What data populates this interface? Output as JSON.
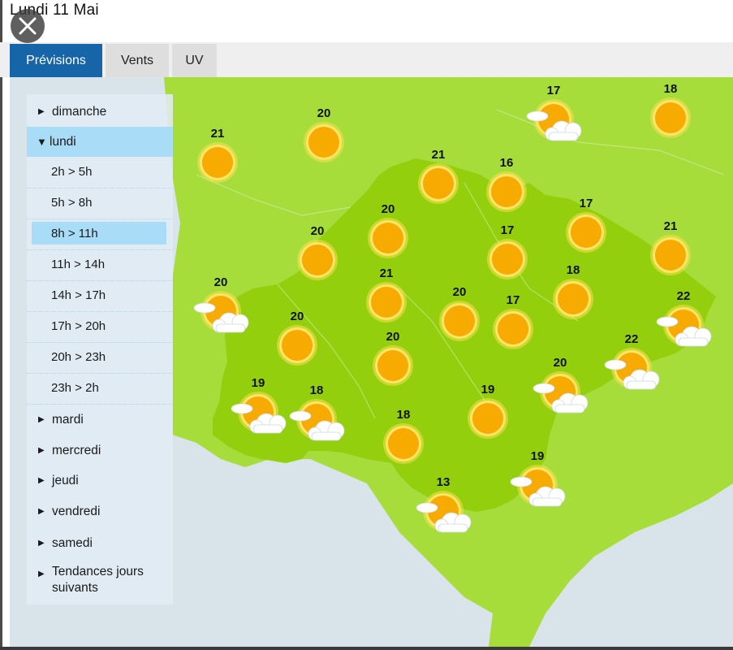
{
  "header": {
    "date": "Lundi  11 Mai"
  },
  "tabs": [
    {
      "label": "Prévisions",
      "active": true
    },
    {
      "label": "Vents",
      "active": false
    },
    {
      "label": "UV",
      "active": false
    }
  ],
  "sidebar": {
    "days_before": [
      {
        "label": "dimanche"
      }
    ],
    "open_day": {
      "label": "lundi"
    },
    "slots": [
      {
        "label": "2h > 5h"
      },
      {
        "label": "5h > 8h"
      },
      {
        "label": "8h > 11h",
        "selected": true
      },
      {
        "label": "11h > 14h"
      },
      {
        "label": "14h > 17h"
      },
      {
        "label": "17h > 20h"
      },
      {
        "label": "20h > 23h"
      },
      {
        "label": "23h > 2h"
      }
    ],
    "days_after": [
      {
        "label": "mardi"
      },
      {
        "label": "mercredi"
      },
      {
        "label": "jeudi"
      },
      {
        "label": "vendredi"
      },
      {
        "label": "samedi"
      },
      {
        "label": "Tendances jours suivants"
      }
    ]
  },
  "map": {
    "colors": {
      "sea": "#d9e3ea",
      "land_outside": "#a6dd3b",
      "region": "#94cf0e",
      "sun": "#f7ab00",
      "cloud": "#ffffff"
    },
    "forecasts": [
      {
        "temp": "17",
        "icon": "sun-cloud-icon"
      },
      {
        "temp": "18",
        "icon": "sun-icon"
      },
      {
        "temp": "20",
        "icon": "sun-icon"
      },
      {
        "temp": "21",
        "icon": "sun-icon"
      },
      {
        "temp": "21",
        "icon": "sun-icon"
      },
      {
        "temp": "16",
        "icon": "sun-icon"
      },
      {
        "temp": "20",
        "icon": "sun-icon"
      },
      {
        "temp": "17",
        "icon": "sun-icon"
      },
      {
        "temp": "20",
        "icon": "sun-icon"
      },
      {
        "temp": "17",
        "icon": "sun-icon"
      },
      {
        "temp": "21",
        "icon": "sun-icon"
      },
      {
        "temp": "20",
        "icon": "sun-cloud-icon"
      },
      {
        "temp": "21",
        "icon": "sun-icon"
      },
      {
        "temp": "18",
        "icon": "sun-icon"
      },
      {
        "temp": "20",
        "icon": "sun-icon"
      },
      {
        "temp": "17",
        "icon": "sun-icon"
      },
      {
        "temp": "22",
        "icon": "sun-cloud-icon"
      },
      {
        "temp": "20",
        "icon": "sun-icon"
      },
      {
        "temp": "20",
        "icon": "sun-icon"
      },
      {
        "temp": "22",
        "icon": "sun-cloud-icon"
      },
      {
        "temp": "20",
        "icon": "sun-cloud-icon"
      },
      {
        "temp": "19",
        "icon": "sun-cloud-icon"
      },
      {
        "temp": "18",
        "icon": "sun-cloud-icon"
      },
      {
        "temp": "19",
        "icon": "sun-icon"
      },
      {
        "temp": "18",
        "icon": "sun-icon"
      },
      {
        "temp": "19",
        "icon": "sun-cloud-icon"
      },
      {
        "temp": "13",
        "icon": "sun-cloud-icon"
      }
    ]
  }
}
